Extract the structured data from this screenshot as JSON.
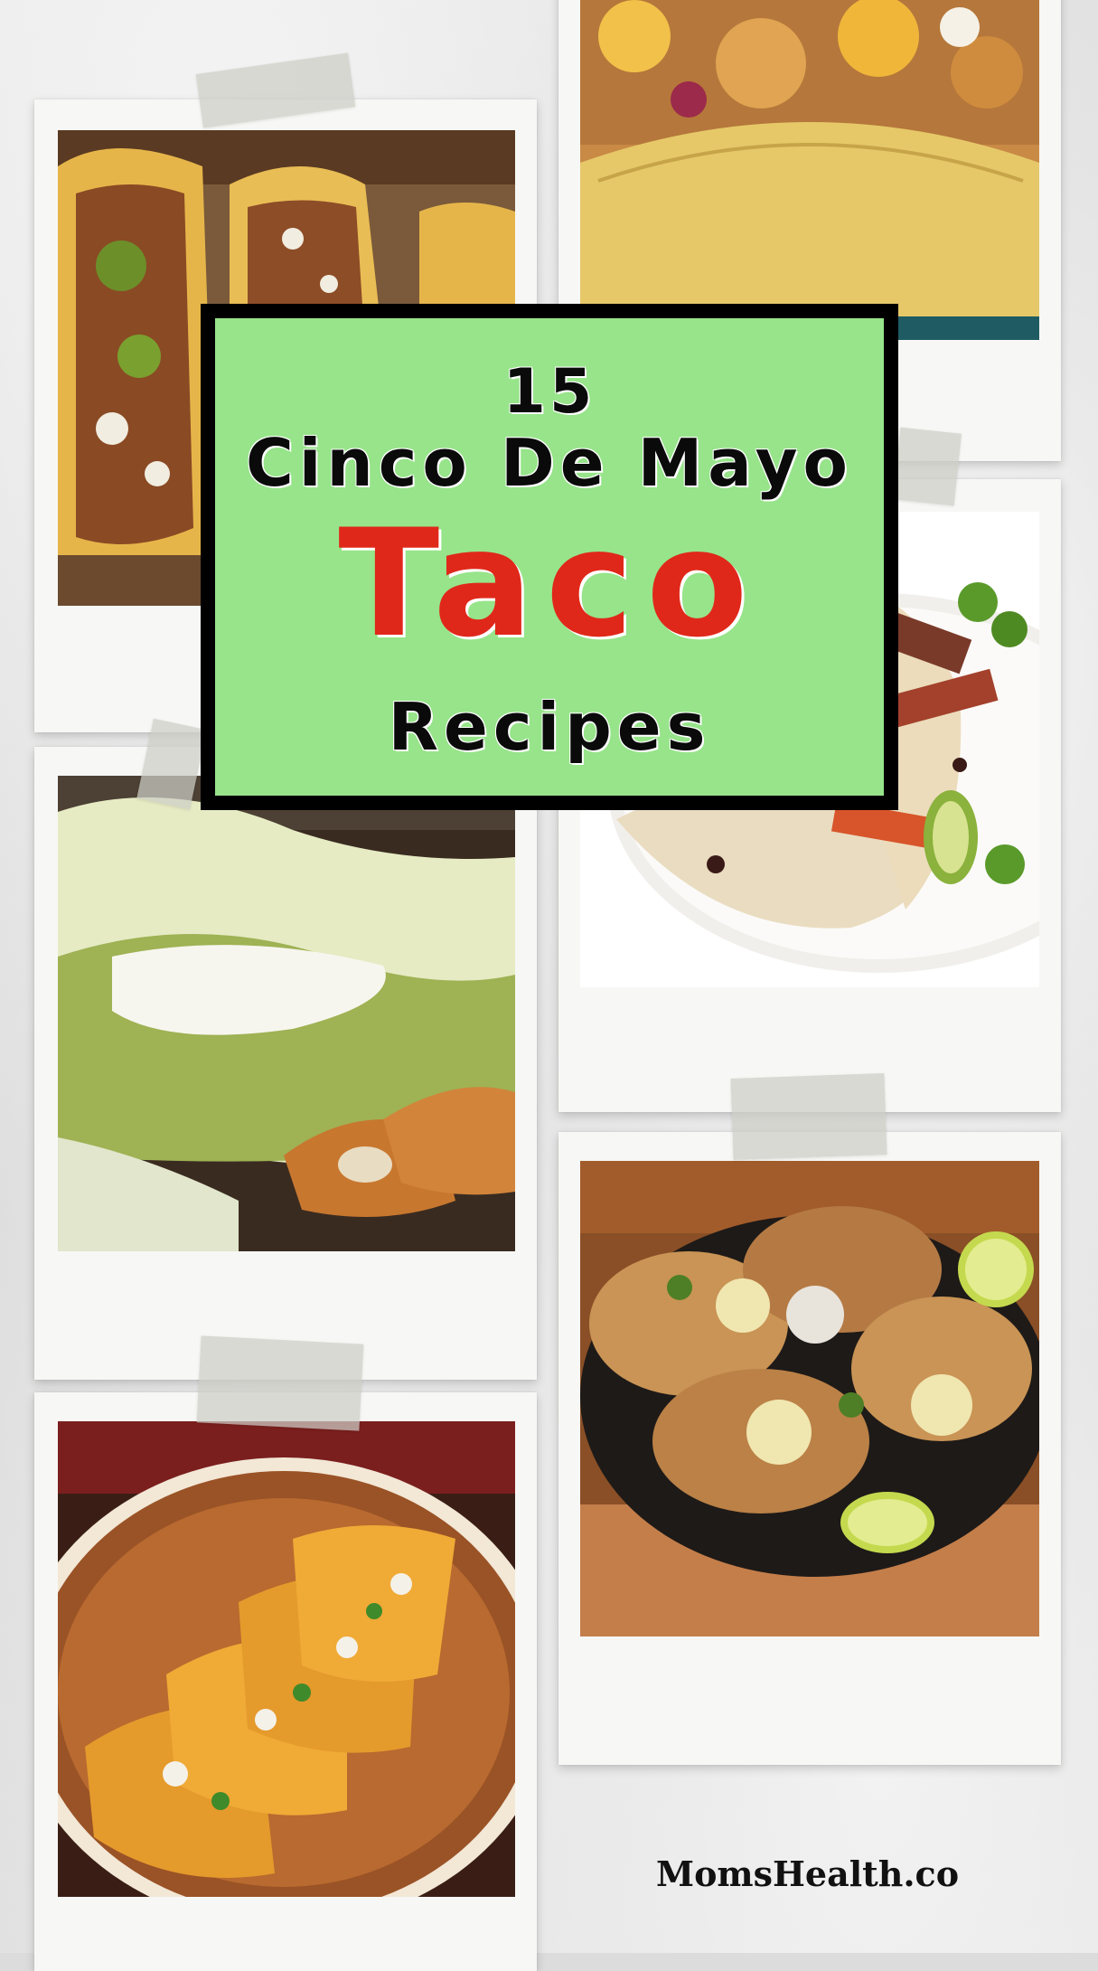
{
  "title": {
    "number": "15",
    "line": "Cinco De Mayo",
    "highlight": "Taco",
    "last": "Recipes"
  },
  "brand": "MomsHealth.co",
  "colors": {
    "title_bg": "#97e48a",
    "title_border": "#000000",
    "highlight": "#e0281a"
  }
}
